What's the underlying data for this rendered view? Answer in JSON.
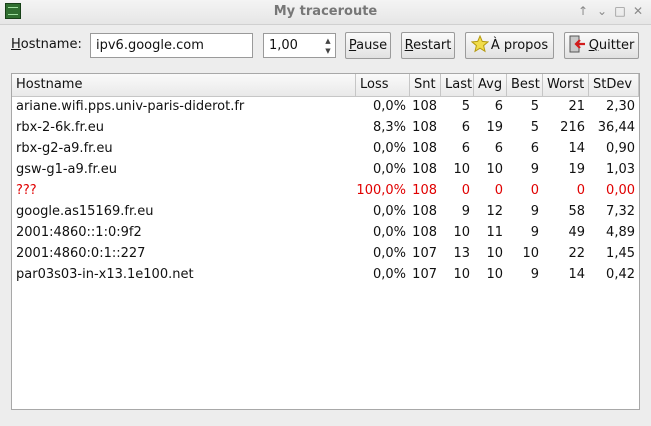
{
  "window": {
    "title": "My traceroute"
  },
  "toolbar": {
    "hostname_label": "Hostname:",
    "hostname_value": "ipv6.google.com",
    "interval_value": "1,00",
    "pause_label": "Pause",
    "restart_label": "Restart",
    "about_label": "À propos",
    "quit_label": "Quitter"
  },
  "table": {
    "columns": [
      "Hostname",
      "Loss",
      "Snt",
      "Last",
      "Avg",
      "Best",
      "Worst",
      "StDev"
    ],
    "rows": [
      {
        "host": "ariane.wifi.pps.univ-paris-diderot.fr",
        "loss": "0,0%",
        "snt": "108",
        "last": "5",
        "avg": "6",
        "best": "5",
        "worst": "21",
        "stdev": "2,30"
      },
      {
        "host": "rbx-2-6k.fr.eu",
        "loss": "8,3%",
        "snt": "108",
        "last": "6",
        "avg": "19",
        "best": "5",
        "worst": "216",
        "stdev": "36,44"
      },
      {
        "host": "rbx-g2-a9.fr.eu",
        "loss": "0,0%",
        "snt": "108",
        "last": "6",
        "avg": "6",
        "best": "6",
        "worst": "14",
        "stdev": "0,90"
      },
      {
        "host": "gsw-g1-a9.fr.eu",
        "loss": "0,0%",
        "snt": "108",
        "last": "10",
        "avg": "10",
        "best": "9",
        "worst": "19",
        "stdev": "1,03"
      },
      {
        "host": "???",
        "loss": "100,0%",
        "snt": "108",
        "last": "0",
        "avg": "0",
        "best": "0",
        "worst": "0",
        "stdev": "0,00"
      },
      {
        "host": "google.as15169.fr.eu",
        "loss": "0,0%",
        "snt": "108",
        "last": "9",
        "avg": "12",
        "best": "9",
        "worst": "58",
        "stdev": "7,32"
      },
      {
        "host": "2001:4860::1:0:9f2",
        "loss": "0,0%",
        "snt": "108",
        "last": "10",
        "avg": "11",
        "best": "9",
        "worst": "49",
        "stdev": "4,89"
      },
      {
        "host": "2001:4860:0:1::227",
        "loss": "0,0%",
        "snt": "107",
        "last": "13",
        "avg": "10",
        "best": "10",
        "worst": "22",
        "stdev": "1,45"
      },
      {
        "host": "par03s03-in-x13.1e100.net",
        "loss": "0,0%",
        "snt": "107",
        "last": "10",
        "avg": "10",
        "best": "9",
        "worst": "14",
        "stdev": "0,42"
      }
    ]
  },
  "colors": {
    "error_row": "#e00000"
  }
}
